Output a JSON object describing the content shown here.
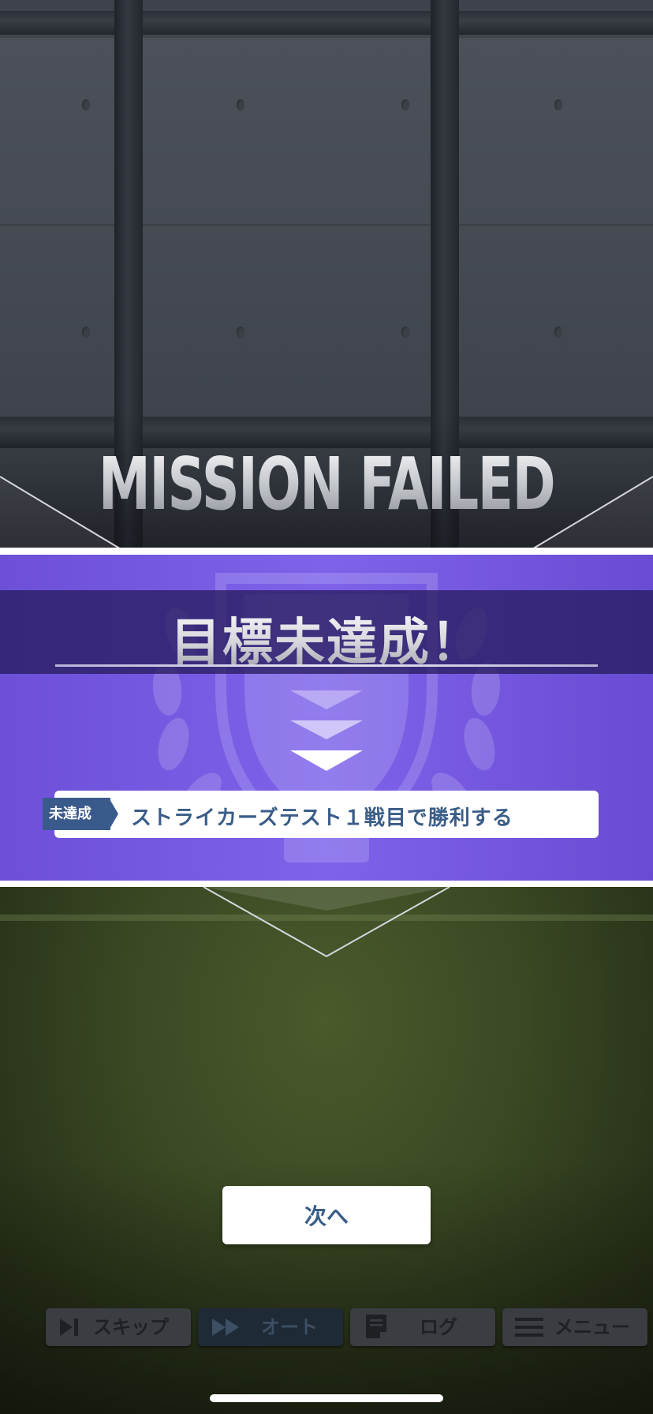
{
  "screen": {
    "title": "MISSION FAILED"
  },
  "result": {
    "heading": "目標未達成！",
    "mission": {
      "status": "未達成",
      "description": "ストライカーズテスト１戦目で勝利する"
    }
  },
  "actions": {
    "next_label": "次へ"
  },
  "toolbar": {
    "skip_label": "スキップ",
    "auto_label": "オート",
    "log_label": "ログ",
    "menu_label": "メニュー"
  },
  "colors": {
    "accent_purple": "#7e63ea",
    "status_blue": "#3b5a8c",
    "text_blue": "#3a5d88"
  },
  "icons": {
    "skip": "skip-icon",
    "auto": "fast-forward-icon",
    "log": "document-icon",
    "menu": "hamburger-icon"
  }
}
